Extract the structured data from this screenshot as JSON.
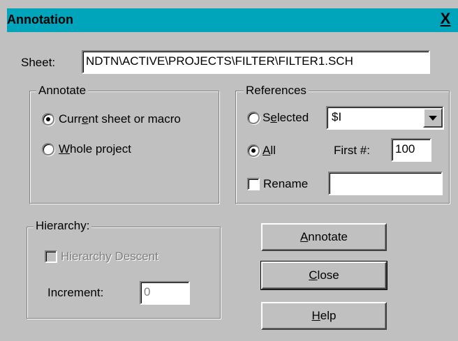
{
  "window": {
    "title": "Annotation",
    "close_glyph": "X"
  },
  "sheet": {
    "label": "Sheet:",
    "value": "NDTN\\ACTIVE\\PROJECTS\\FILTER\\FILTER1.SCH"
  },
  "annotate_group": {
    "title": "Annotate",
    "options": [
      {
        "pre": "Curr",
        "key": "e",
        "post": "nt sheet or macro",
        "selected": true
      },
      {
        "pre": "",
        "key": "W",
        "post": "hole project",
        "selected": false
      }
    ]
  },
  "references_group": {
    "title": "References",
    "selected_option": {
      "pre": "S",
      "key": "e",
      "post": "lected",
      "selected": false
    },
    "selected_dropdown_value": "$I",
    "all_option": {
      "pre": "",
      "key": "A",
      "post": "ll",
      "selected": true
    },
    "first_label": "First #:",
    "first_value": "100",
    "rename_label": "Rename",
    "rename_checked": false,
    "rename_value": ""
  },
  "hierarchy_group": {
    "title": "Hierarchy:",
    "descent_label": "Hierarchy Descent",
    "descent_checked": false,
    "increment_label": "Increment:",
    "increment_value": "0"
  },
  "buttons": {
    "annotate": {
      "pre": "",
      "key": "A",
      "post": "nnotate"
    },
    "close": {
      "pre": "",
      "key": "C",
      "post": "lose"
    },
    "help": {
      "pre": "",
      "key": "H",
      "post": "elp"
    }
  },
  "icons": {
    "close": "close-icon",
    "dropdown": "chevron-down-icon"
  },
  "colors": {
    "titlebar": "#00a5bb",
    "face": "#c0c0c0"
  }
}
